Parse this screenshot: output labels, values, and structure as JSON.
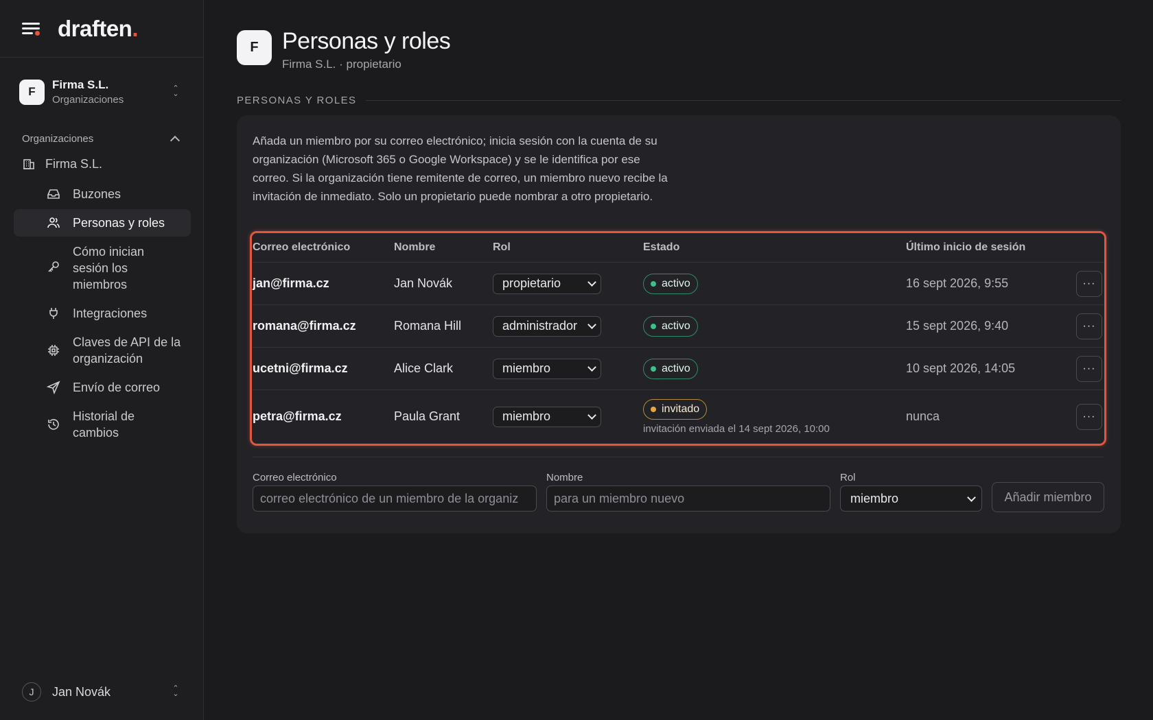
{
  "brand": {
    "name": "draften",
    "dot": "."
  },
  "org_switcher": {
    "initial": "F",
    "name": "Firma S.L.",
    "sub": "Organizaciones"
  },
  "sidebar": {
    "section": "Organizaciones",
    "root": "Firma S.L.",
    "items": [
      {
        "label": "Buzones",
        "icon": "inbox-icon"
      },
      {
        "label": "Personas y roles",
        "icon": "users-icon",
        "active": true
      },
      {
        "label": "Cómo inician sesión los miembros",
        "icon": "key-icon"
      },
      {
        "label": "Integraciones",
        "icon": "plug-icon"
      },
      {
        "label": "Claves de API de la organización",
        "icon": "chip-icon"
      },
      {
        "label": "Envío de correo",
        "icon": "send-icon"
      },
      {
        "label": "Historial de cambios",
        "icon": "history-icon"
      }
    ]
  },
  "user": {
    "initial": "J",
    "name": "Jan Novák"
  },
  "header": {
    "initial": "F",
    "title": "Personas y roles",
    "subtitle": "Firma S.L. · propietario"
  },
  "section_label": "PERSONAS Y ROLES",
  "intro": "Añada un miembro por su correo electrónico; inicia sesión con la cuenta de su organización (Microsoft 365 o Google Workspace) y se le identifica por ese correo. Si la organización tiene remitente de correo, un miembro nuevo recibe la invitación de inmediato. Solo un propietario puede nombrar a otro propietario.",
  "table": {
    "headers": [
      "Correo electrónico",
      "Nombre",
      "Rol",
      "Estado",
      "Último inicio de sesión"
    ],
    "rows": [
      {
        "email": "jan@firma.cz",
        "name": "Jan Novák",
        "role": "propietario",
        "status": "activo",
        "last": "16 sept 2026, 9:55"
      },
      {
        "email": "romana@firma.cz",
        "name": "Romana Hill",
        "role": "administrador",
        "status": "activo",
        "last": "15 sept 2026, 9:40"
      },
      {
        "email": "ucetni@firma.cz",
        "name": "Alice Clark",
        "role": "miembro",
        "status": "activo",
        "last": "10 sept 2026, 14:05"
      },
      {
        "email": "petra@firma.cz",
        "name": "Paula Grant",
        "role": "miembro",
        "status": "invitado",
        "note": "invitación enviada el 14 sept 2026, 10:00",
        "last": "nunca"
      }
    ],
    "more_label": "···"
  },
  "form": {
    "email_label": "Correo electrónico",
    "email_placeholder": "correo electrónico de un miembro de la organiz",
    "name_label": "Nombre",
    "name_placeholder": "para un miembro nuevo",
    "role_label": "Rol",
    "role_value": "miembro",
    "submit_label": "Añadir miembro"
  },
  "colors": {
    "accent": "#e2553f",
    "active": "#3ac08a",
    "invited": "#e8a640",
    "background": "#1b1b1d"
  }
}
